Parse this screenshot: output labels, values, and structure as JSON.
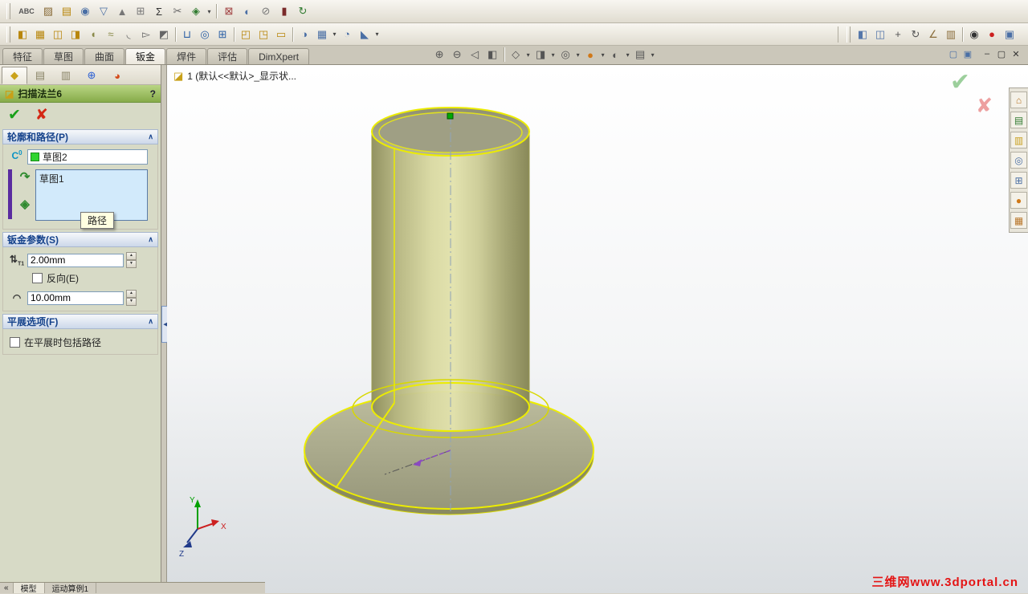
{
  "colors": {
    "pm_title_green": "#9cbb5d",
    "selection_blue": "#d2eafb",
    "highlight_yellow": "#ecec00",
    "model_olive": "#c8c890",
    "watermark_red": "#e41414",
    "group_header_blue": "#15428b",
    "path_band_purple": "#5a2ca0"
  },
  "toolbars": {
    "row1": [
      {
        "handle": true
      },
      {
        "name": "spell-check-icon",
        "glyph": "ABC",
        "wide": true,
        "color": "#555"
      },
      {
        "name": "format-painter-icon",
        "glyph": "▨",
        "color": "#8a6d3b"
      },
      {
        "name": "note-icon",
        "glyph": "▤",
        "color": "#b8860b"
      },
      {
        "name": "balloon-icon",
        "glyph": "◉",
        "color": "#4a6fa5"
      },
      {
        "name": "surface-finish-icon",
        "glyph": "▽",
        "color": "#4a6fa5"
      },
      {
        "name": "weld-symbol-icon",
        "glyph": "▲",
        "color": "#777"
      },
      {
        "name": "geometric-tolerance-icon",
        "glyph": "⊞",
        "color": "#777"
      },
      {
        "name": "equation-sigma-icon",
        "glyph": "Σ",
        "color": "#333"
      },
      {
        "name": "trim-entities-icon",
        "glyph": "✂",
        "color": "#666"
      },
      {
        "name": "block-icon",
        "glyph": "◈",
        "color": "#2f7a2f",
        "drop": true
      },
      {
        "sep": true
      },
      {
        "name": "dimension-icon",
        "glyph": "⊠",
        "color": "#a04040"
      },
      {
        "name": "model-items-icon",
        "glyph": "◐",
        "color": "#4a6fa5"
      },
      {
        "name": "no-preview-icon",
        "glyph": "⊘",
        "color": "#777"
      },
      {
        "name": "bar-display-icon",
        "glyph": "▮",
        "color": "#7a2a2a"
      },
      {
        "name": "rebuild-icon",
        "glyph": "↻",
        "color": "#2f7a2f"
      }
    ],
    "row2_left": [
      {
        "handle": true
      },
      {
        "name": "base-flange-icon",
        "glyph": "◧",
        "color": "#b8860b"
      },
      {
        "name": "swept-flange-icon",
        "glyph": "▦",
        "color": "#b8860b"
      },
      {
        "name": "edge-flange-icon",
        "glyph": "◫",
        "color": "#b8860b"
      },
      {
        "name": "miter-flange-icon",
        "glyph": "◨",
        "color": "#b8860b"
      },
      {
        "name": "hem-icon",
        "glyph": "◖",
        "color": "#8a8a4a"
      },
      {
        "name": "jog-icon",
        "glyph": "≈",
        "color": "#8a8a4a"
      },
      {
        "name": "sketched-bend-icon",
        "glyph": "◟",
        "color": "#666"
      },
      {
        "name": "cross-break-icon",
        "glyph": "▻",
        "color": "#666"
      },
      {
        "name": "closed-corner-icon",
        "glyph": "◩",
        "color": "#666"
      },
      {
        "sep": true
      },
      {
        "name": "extruded-cut-icon",
        "glyph": "⊔",
        "color": "#2a5fa5"
      },
      {
        "name": "simple-hole-icon",
        "glyph": "◎",
        "color": "#2a5fa5"
      },
      {
        "name": "vent-icon",
        "glyph": "⊞",
        "color": "#2a5fa5"
      },
      {
        "sep": true
      },
      {
        "name": "unfold-icon",
        "glyph": "◰",
        "color": "#b8860b"
      },
      {
        "name": "fold-icon",
        "glyph": "◳",
        "color": "#b8860b"
      },
      {
        "name": "flatten-icon",
        "glyph": "▭",
        "color": "#b8860b"
      },
      {
        "sep": true
      },
      {
        "name": "mirror-icon",
        "glyph": "◑",
        "color": "#4a6fa5"
      },
      {
        "name": "linear-pattern-icon",
        "glyph": "▦",
        "color": "#4a6fa5",
        "drop": true
      },
      {
        "name": "fillet-icon",
        "glyph": "◔",
        "color": "#4a6fa5"
      },
      {
        "name": "chamfer-icon",
        "glyph": "◣",
        "color": "#4a6fa5",
        "drop": true
      }
    ],
    "row2_right": [
      {
        "handle": true
      },
      {
        "name": "assembly-icon",
        "glyph": "◧",
        "color": "#5577aa"
      },
      {
        "name": "drawing-icon",
        "glyph": "◫",
        "color": "#5577aa"
      },
      {
        "name": "pan-icon",
        "glyph": "+",
        "color": "#555"
      },
      {
        "name": "rotate-view-icon",
        "glyph": "↻",
        "color": "#555"
      },
      {
        "name": "measure-icon",
        "glyph": "∠",
        "color": "#8a6d3b"
      },
      {
        "name": "mass-properties-icon",
        "glyph": "▥",
        "color": "#8a6d3b"
      },
      {
        "sep": true
      },
      {
        "name": "screen-capture-icon",
        "glyph": "◉",
        "color": "#333"
      },
      {
        "name": "record-video-icon",
        "glyph": "●",
        "color": "#cc2020"
      },
      {
        "name": "image-export-icon",
        "glyph": "▣",
        "color": "#4a6fa5"
      }
    ],
    "view_tools": [
      {
        "name": "zoom-fit-icon",
        "glyph": "⊕",
        "color": "#555"
      },
      {
        "name": "zoom-area-icon",
        "glyph": "⊖",
        "color": "#555"
      },
      {
        "name": "previous-view-icon",
        "glyph": "◁",
        "color": "#555"
      },
      {
        "name": "section-view-icon",
        "glyph": "◧",
        "color": "#555"
      },
      {
        "sep": true
      },
      {
        "name": "view-orientation-icon",
        "glyph": "◇",
        "color": "#555",
        "drop": true
      },
      {
        "name": "display-style-icon",
        "glyph": "◨",
        "color": "#555",
        "drop": true
      },
      {
        "name": "hide-show-items-icon",
        "glyph": "◎",
        "color": "#555",
        "drop": true
      },
      {
        "name": "edit-appearance-icon",
        "glyph": "●",
        "color": "#d07818",
        "drop": true
      },
      {
        "name": "apply-scene-icon",
        "glyph": "◐",
        "color": "#555",
        "drop": true
      },
      {
        "name": "view-settings-icon",
        "glyph": "▤",
        "color": "#555",
        "drop": true
      }
    ]
  },
  "window_controls": {
    "extra": [
      {
        "name": "window-cascade-icon",
        "glyph": "▢",
        "color": "#4a6fa5"
      },
      {
        "name": "window-tile-icon",
        "glyph": "▣",
        "color": "#4a6fa5"
      }
    ],
    "main": [
      {
        "name": "minimize-button",
        "glyph": "–",
        "color": "#333"
      },
      {
        "name": "restore-button",
        "glyph": "▢",
        "color": "#333"
      },
      {
        "name": "close-button",
        "glyph": "✕",
        "color": "#333"
      }
    ]
  },
  "command_tabs": {
    "items": [
      {
        "label": "特征",
        "active": false
      },
      {
        "label": "草图",
        "active": false
      },
      {
        "label": "曲面",
        "active": false
      },
      {
        "label": "钣金",
        "active": true
      },
      {
        "label": "焊件",
        "active": false
      },
      {
        "label": "评估",
        "active": false
      },
      {
        "label": "DimXpert",
        "active": false
      }
    ]
  },
  "pm": {
    "tabs": [
      {
        "name": "feature-manager-tab",
        "glyph": "◆",
        "color": "#caa21a",
        "active": true
      },
      {
        "name": "property-manager-tab",
        "glyph": "▤",
        "color": "#8a8468",
        "active": false
      },
      {
        "name": "configuration-manager-tab",
        "glyph": "▥",
        "color": "#8a8468",
        "active": false
      },
      {
        "name": "dimxpert-manager-tab",
        "glyph": "⊕",
        "color": "#2a5fd4",
        "active": false
      },
      {
        "name": "display-manager-tab",
        "glyph": "◕",
        "color": "#d44a1a",
        "active": false
      }
    ],
    "title_icon": "◪",
    "title": "扫描法兰6",
    "help_glyph": "?",
    "ok_glyph": "✔",
    "cancel_glyph": "✘",
    "chevron": "∧",
    "spin_up": "▲",
    "spin_down": "▼",
    "groups": {
      "profile_path": {
        "title": "轮廓和路径(P)",
        "profile_icon": "C",
        "profile_icon_sup": "0",
        "profile_value": "草图2",
        "path_icon": "↷",
        "aux_icon": "◈",
        "path_value": "草图1",
        "tooltip": "路径"
      },
      "sheet_params": {
        "title": "钣金参数(S)",
        "thickness_icon": "⇅",
        "thickness_sub": "T1",
        "thickness_value": "2.00mm",
        "reverse_label": "反向(E)",
        "radius_icon": "◠",
        "radius_value": "10.00mm"
      },
      "flatten": {
        "title": "平展选项(F)",
        "include_label": "在平展时包括路径"
      }
    }
  },
  "ui": {
    "splitter_glyph": "◀"
  },
  "feature_tree": {
    "icon_glyph": "◪",
    "label": "1 (默认<<默认>_显示状..."
  },
  "viewport": {
    "confirm_glyph": "✔",
    "cancel_glyph": "✘",
    "watermark": "三维网www.3dportal.cn",
    "triad": {
      "x": "X",
      "y": "Y",
      "z": "Z"
    }
  },
  "task_pane": [
    {
      "name": "solidworks-resources-icon",
      "glyph": "⌂",
      "color": "#b8762a"
    },
    {
      "name": "design-library-icon",
      "glyph": "▤",
      "color": "#2f7a2f"
    },
    {
      "name": "file-explorer-icon",
      "glyph": "▥",
      "color": "#c8a020"
    },
    {
      "name": "search-icon",
      "glyph": "◎",
      "color": "#4a6fa5"
    },
    {
      "name": "view-palette-icon",
      "glyph": "⊞",
      "color": "#4a6fa5"
    },
    {
      "name": "appearances-icon",
      "glyph": "●",
      "color": "#d07818"
    },
    {
      "name": "custom-properties-icon",
      "glyph": "▦",
      "color": "#b8762a"
    }
  ],
  "status_tabs": {
    "collapse": "«",
    "items": [
      {
        "label": "模型",
        "active": true
      },
      {
        "label": "运动算例1",
        "active": false
      }
    ]
  }
}
